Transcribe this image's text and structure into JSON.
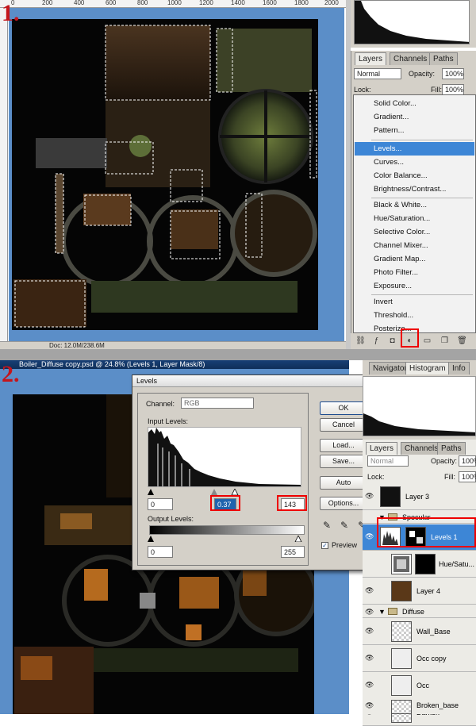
{
  "steps": {
    "step1": "1.",
    "step2": "2."
  },
  "ruler": {
    "labels": [
      "0",
      "200",
      "400",
      "600",
      "800",
      "1000",
      "1200",
      "1400",
      "1600",
      "1800",
      "2000"
    ]
  },
  "panel1": {
    "status_text": "Doc: 12.0M/238.6M",
    "layers_tabs": [
      "Layers",
      "Channels",
      "Paths"
    ],
    "blend_mode": "Normal",
    "opacity_label": "Opacity:",
    "opacity_value": "100%",
    "lock_label": "Lock:",
    "fill_label": "Fill:",
    "fill_value": "100%",
    "adjustment_menu": [
      "Solid Color...",
      "Gradient...",
      "Pattern...",
      "Levels...",
      "Curves...",
      "Color Balance...",
      "Brightness/Contrast...",
      "Black & White...",
      "Hue/Saturation...",
      "Selective Color...",
      "Channel Mixer...",
      "Gradient Map...",
      "Photo Filter...",
      "Exposure...",
      "Invert",
      "Threshold...",
      "Posterize..."
    ],
    "highlighted_item": "Levels..."
  },
  "panel2": {
    "doc_title": "Boiler_Diffuse copy.psd @ 24.8% (Levels 1, Layer Mask/8)",
    "levels": {
      "title": "Levels",
      "channel_label": "Channel:",
      "channel_value": "RGB",
      "input_label": "Input Levels:",
      "input_black": "0",
      "input_gamma": "0.37",
      "input_white": "143",
      "output_label": "Output Levels:",
      "output_black": "0",
      "output_white": "255",
      "buttons": {
        "ok": "OK",
        "cancel": "Cancel",
        "load": "Load...",
        "save": "Save...",
        "auto": "Auto",
        "options": "Options..."
      },
      "preview_label": "Preview",
      "preview_checked": true
    },
    "top_tabs": [
      "Navigator",
      "Histogram",
      "Info"
    ],
    "layers_tabs": [
      "Layers",
      "Channels",
      "Paths"
    ],
    "blend_mode": "Normal",
    "opacity_label": "Opacity:",
    "opacity_value": "100%",
    "lock_label": "Lock:",
    "fill_label": "Fill:",
    "fill_value": "100%",
    "layers": [
      {
        "name": "Layer 3",
        "kind": "layer"
      },
      {
        "name": "Specular",
        "kind": "group"
      },
      {
        "name": "Levels 1",
        "kind": "adjustment",
        "selected": true
      },
      {
        "name": "Hue/Satu...",
        "kind": "adjustment"
      },
      {
        "name": "Layer 4",
        "kind": "layer"
      },
      {
        "name": "Diffuse",
        "kind": "group"
      },
      {
        "name": "Wall_Base",
        "kind": "layer"
      },
      {
        "name": "Occ copy",
        "kind": "layer"
      },
      {
        "name": "Occ",
        "kind": "layer"
      },
      {
        "name": "Darken",
        "kind": "layer"
      },
      {
        "name": "Broken_base",
        "kind": "layer"
      }
    ]
  },
  "colors": {
    "highlight_box": "#e00000",
    "canvas_bg": "#5b8ec8",
    "menu_highlight": "#3d86d6",
    "step_label": "#c4161c"
  }
}
